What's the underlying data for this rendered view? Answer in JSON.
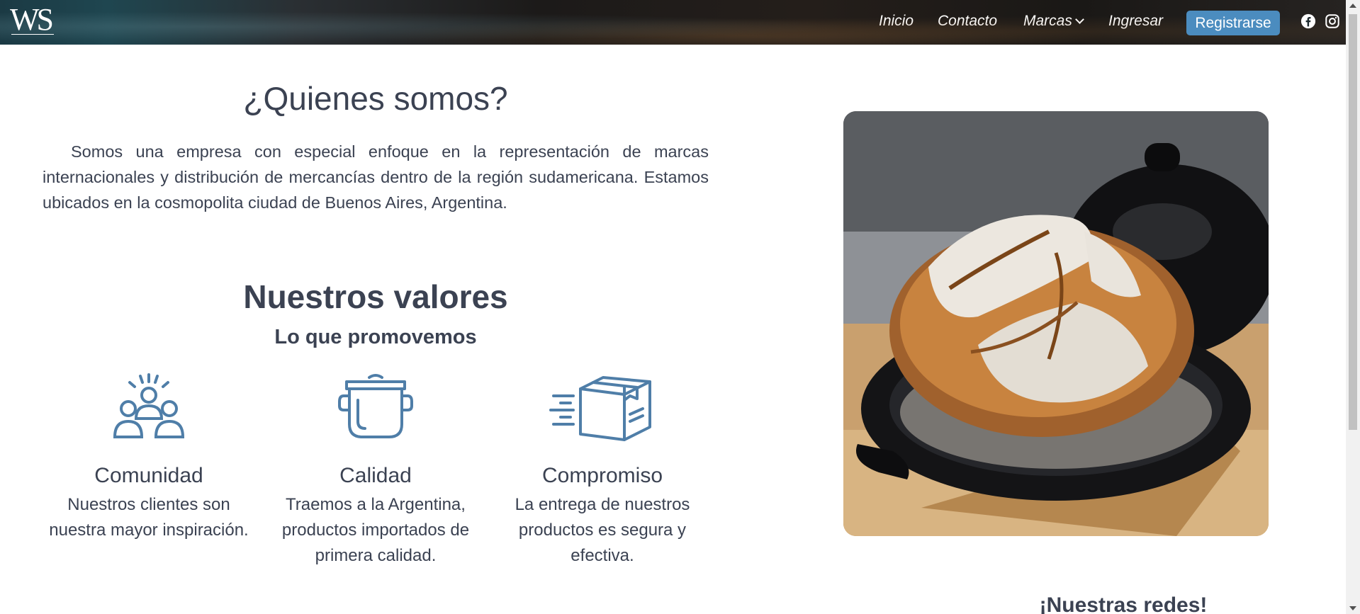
{
  "navbar": {
    "logo": "WS",
    "links": [
      "Inicio",
      "Contacto",
      "Marcas",
      "Ingresar"
    ],
    "register": "Registrarse",
    "social_icons": [
      "facebook-icon",
      "instagram-icon"
    ]
  },
  "about": {
    "title": "¿Quienes somos?",
    "text": "Somos una empresa con especial enfoque en la representación de marcas internacionales y distribución de mercancías dentro de la región sudamericana. Estamos ubicados en la cosmopolita ciudad de Buenos Aires, Argentina."
  },
  "values": {
    "title": "Nuestros valores",
    "subtitle": "Lo que promovemos",
    "items": [
      {
        "icon": "community-icon",
        "title": "Comunidad",
        "desc": "Nuestros clientes son nuestra mayor inspiración."
      },
      {
        "icon": "pot-icon",
        "title": "Calidad",
        "desc": "Traemos a la Argentina, productos importados de primera calidad."
      },
      {
        "icon": "delivery-box-icon",
        "title": "Compromiso",
        "desc": "La entrega de nuestros productos es segura y efectiva."
      }
    ]
  },
  "social": {
    "title": "¡Nuestras redes!"
  },
  "colors": {
    "accent": "#4b8cbf",
    "icon_stroke": "#4f7ea8",
    "text": "#3b4252"
  }
}
